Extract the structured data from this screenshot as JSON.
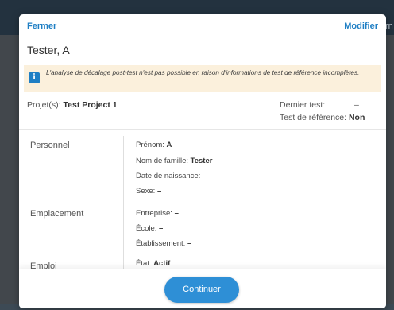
{
  "background": {
    "top_button_label": "rn"
  },
  "modal": {
    "close_label": "Fermer",
    "edit_label": "Modifier",
    "patient_name": "Tester, A",
    "notice": {
      "icon": "info-icon",
      "text": "L'analyse de décalage post-test n'est pas possible en raison d'informations de test de référence incomplètes."
    },
    "summary": {
      "projects_label": "Projet(s):",
      "projects_value": "Test Project 1",
      "last_test_label": "Dernier test:",
      "last_test_value": "–",
      "reference_test_label": "Test de référence:",
      "reference_test_value": "Non"
    },
    "sections": {
      "personal": {
        "title": "Personnel",
        "first_name_label": "Prénom:",
        "first_name_value": "A",
        "last_name_label": "Nom de famille:",
        "last_name_value": "Tester",
        "dob_label": "Date de naissance:",
        "dob_value": "–",
        "sex_label": "Sexe:",
        "sex_value": "–"
      },
      "location": {
        "title": "Emplacement",
        "company_label": "Entreprise:",
        "company_value": "–",
        "school_label": "École:",
        "school_value": "–",
        "facility_label": "Établissement:",
        "facility_value": "–"
      },
      "employment": {
        "title": "Emploi",
        "status_label": "État:",
        "status_value": "Actif"
      }
    },
    "continue_label": "Continuer"
  },
  "colors": {
    "accent": "#2e8fd6",
    "link": "#1f7fc4",
    "notice_bg": "#fbf0dc",
    "header_bg": "#23323f"
  }
}
